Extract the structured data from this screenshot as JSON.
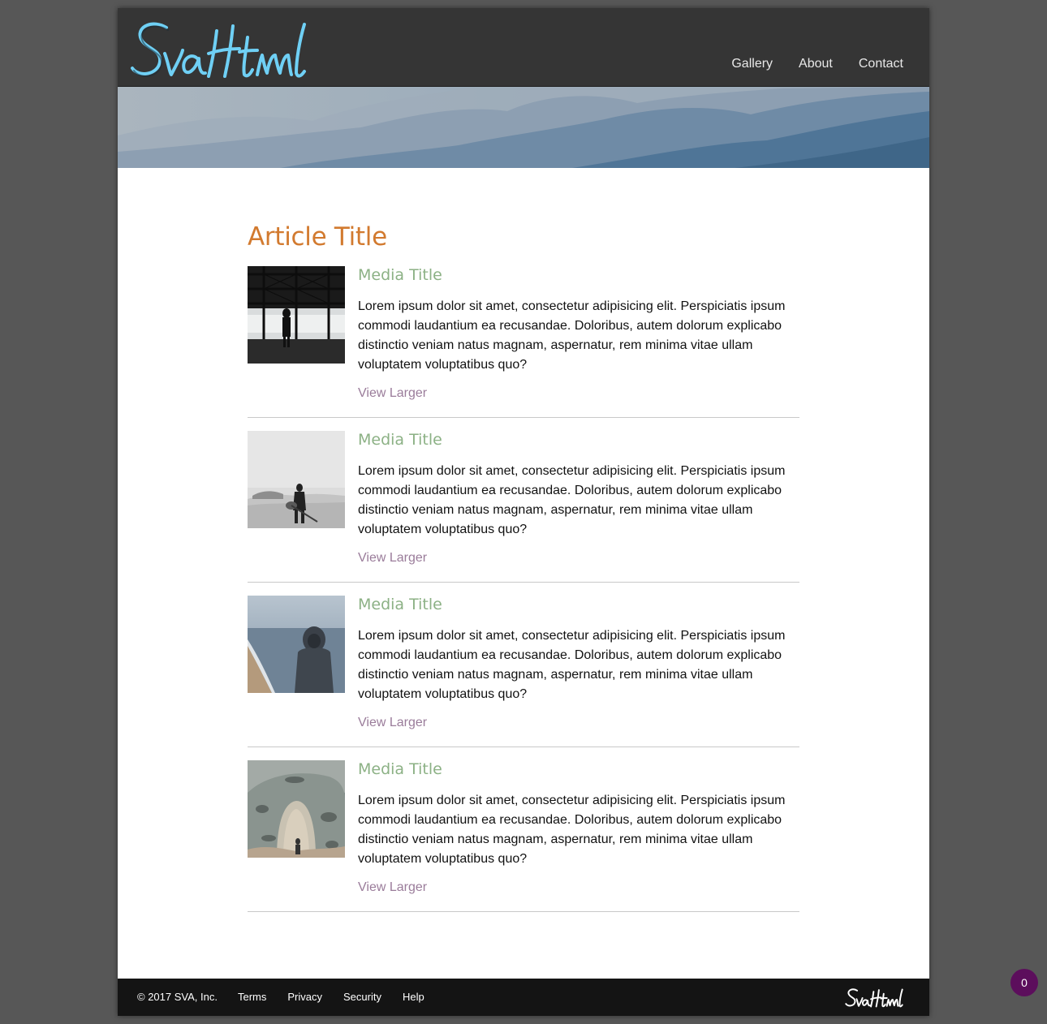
{
  "header": {
    "logo_text": "SvaHtml",
    "nav": [
      {
        "label": "Gallery"
      },
      {
        "label": "About"
      },
      {
        "label": "Contact"
      }
    ]
  },
  "article": {
    "title": "Article Title",
    "items": [
      {
        "title": "Media Title",
        "text": "Lorem ipsum dolor sit amet, consectetur adipisicing elit. Perspiciatis ipsum commodi laudantium ea recusandae. Doloribus, autem dolorum explicabo distinctio veniam natus magnam, aspernatur, rem minima vitae ullam voluptatem voluptatibus quo?",
        "link": "View Larger",
        "image": "man-in-hangar"
      },
      {
        "title": "Media Title",
        "text": "Lorem ipsum dolor sit amet, consectetur adipisicing elit. Perspiciatis ipsum commodi laudantium ea recusandae. Doloribus, autem dolorum explicabo distinctio veniam natus magnam, aspernatur, rem minima vitae ullam voluptatem voluptatibus quo?",
        "link": "View Larger",
        "image": "guitarist-on-beach"
      },
      {
        "title": "Media Title",
        "text": "Lorem ipsum dolor sit amet, consectetur adipisicing elit. Perspiciatis ipsum commodi laudantium ea recusandae. Doloribus, autem dolorum explicabo distinctio veniam natus magnam, aspernatur, rem minima vitae ullam voluptatem voluptatibus quo?",
        "link": "View Larger",
        "image": "hooded-person-by-sea"
      },
      {
        "title": "Media Title",
        "text": "Lorem ipsum dolor sit amet, consectetur adipisicing elit. Perspiciatis ipsum commodi laudantium ea recusandae. Doloribus, autem dolorum explicabo distinctio veniam natus magnam, aspernatur, rem minima vitae ullam voluptatem voluptatibus quo?",
        "link": "View Larger",
        "image": "rock-arch"
      }
    ]
  },
  "footer": {
    "copyright": "© 2017 SVA, Inc.",
    "links": [
      {
        "label": "Terms"
      },
      {
        "label": "Privacy"
      },
      {
        "label": "Security"
      },
      {
        "label": "Help"
      }
    ],
    "logo_text": "SvaHtml"
  },
  "badge": {
    "count": "0"
  },
  "colors": {
    "background": "#575757",
    "header": "#353535",
    "logo": "#6fd0f5",
    "article_title": "#d27a2f",
    "media_title": "#8cb185",
    "link": "#9a7c9a",
    "footer": "#141414",
    "badge": "#5c0e5c"
  }
}
